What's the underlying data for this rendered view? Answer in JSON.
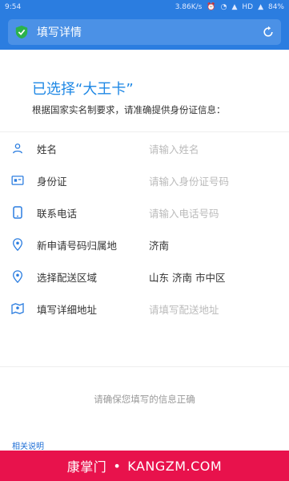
{
  "status": {
    "time": "9:54",
    "speed": "3.86K/s",
    "network": "HD",
    "battery": "84%"
  },
  "urlbar": {
    "title": "填写详情"
  },
  "header": {
    "title": "已选择“大王卡”",
    "subtitle": "根据国家实名制要求，请准确提供身份证信息："
  },
  "form": {
    "rows": [
      {
        "label": "姓名",
        "placeholder": "请输入姓名",
        "value": ""
      },
      {
        "label": "身份证",
        "placeholder": "请输入身份证号码",
        "value": ""
      },
      {
        "label": "联系电话",
        "placeholder": "请输入电话号码",
        "value": ""
      },
      {
        "label": "新申请号码归属地",
        "placeholder": "",
        "value": "济南"
      },
      {
        "label": "选择配送区域",
        "placeholder": "",
        "value": "山东 济南 市中区"
      },
      {
        "label": "填写详细地址",
        "placeholder": "请填写配送地址",
        "value": ""
      }
    ]
  },
  "note": "请确保您填写的信息正确",
  "link": "相关说明",
  "footer": {
    "cn": "康掌门",
    "sep": "•",
    "en": "KANGZM.COM"
  },
  "colors": {
    "primary": "#2b7de0",
    "accent": "#1f88e5",
    "footer": "#e8124c",
    "placeholder": "#bbbbbb"
  }
}
